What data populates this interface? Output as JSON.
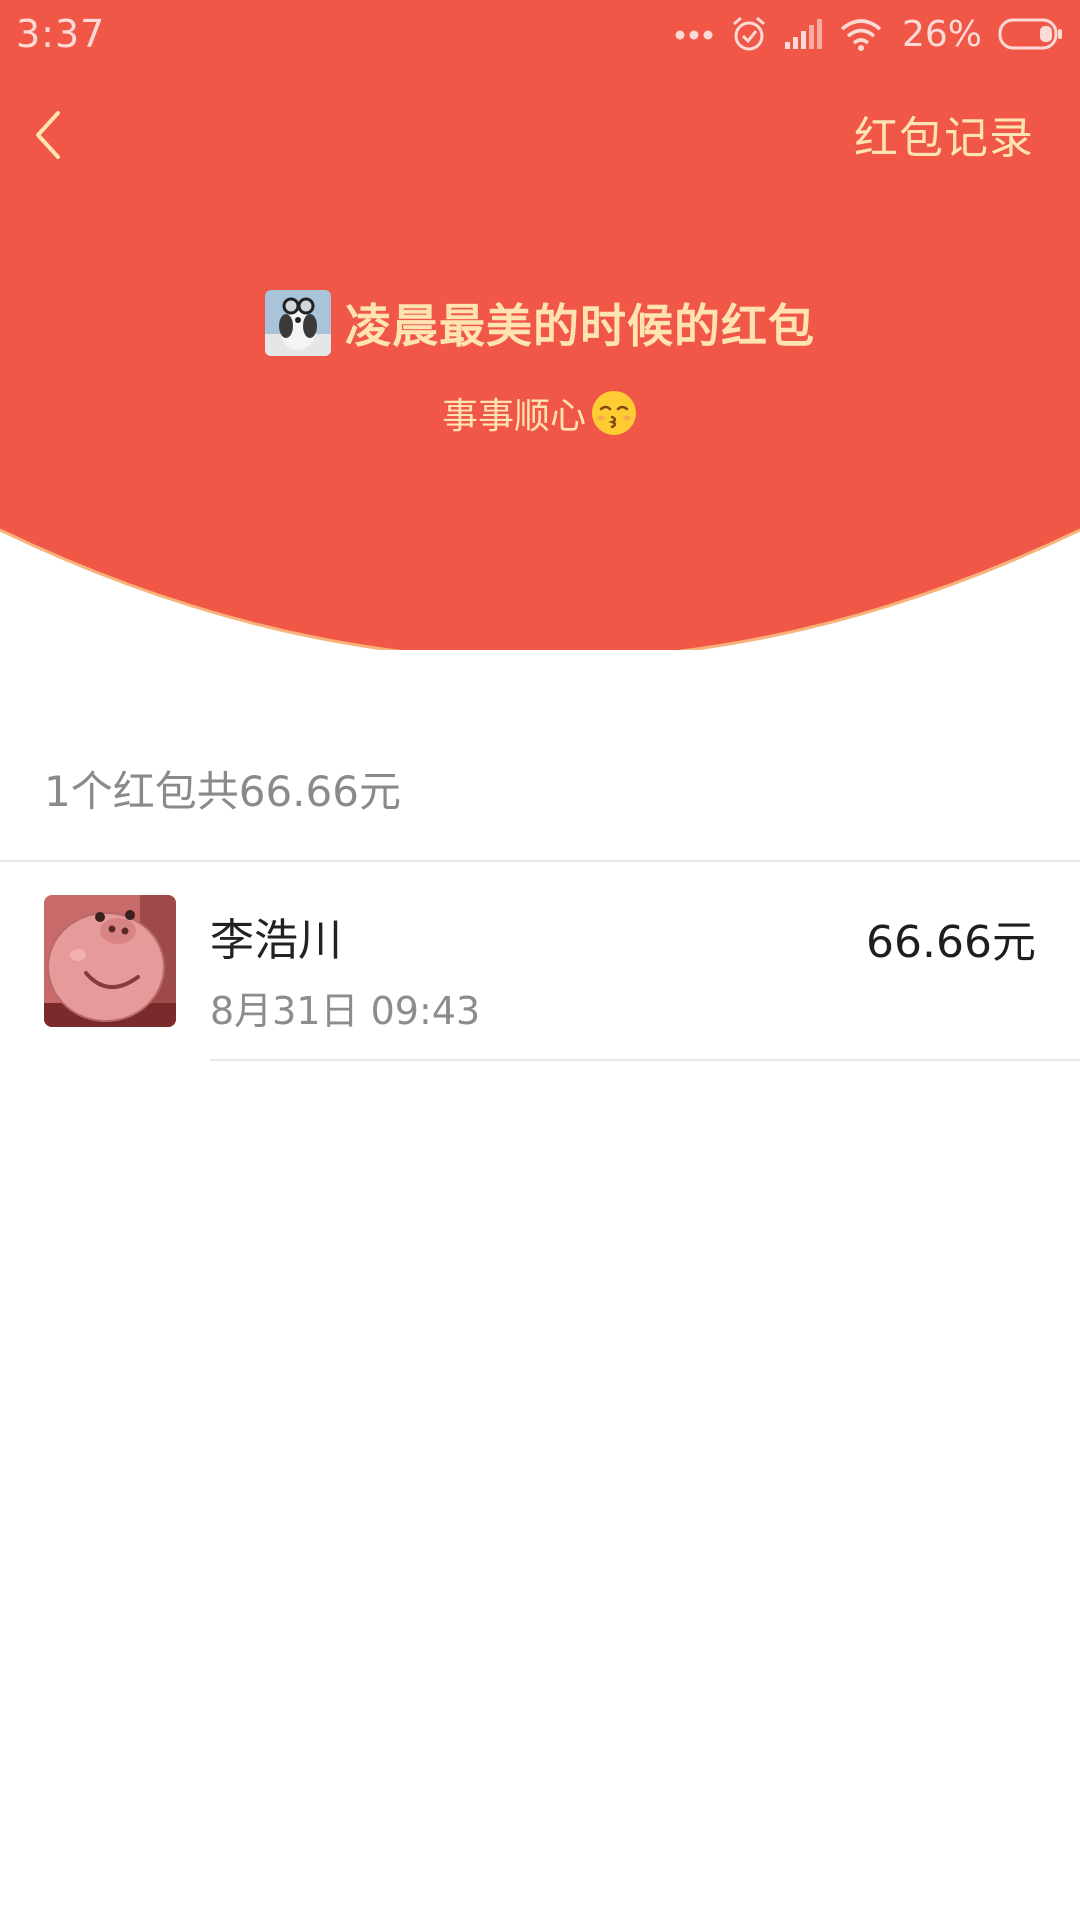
{
  "status_bar": {
    "time": "3:37",
    "battery": "26%"
  },
  "nav": {
    "back_icon": "chevron-left-icon",
    "records_label": "红包记录"
  },
  "packet": {
    "sender_title": "凌晨最美的时候的红包",
    "greeting": "事事顺心"
  },
  "summary": {
    "text": "1个红包共66.66元"
  },
  "records": [
    {
      "name": "李浩川",
      "time": "8月31日  09:43",
      "amount": "66.66元"
    }
  ],
  "colors": {
    "header_red": "#f15747",
    "gold_text": "#ffe3b3",
    "curve_edge": "#f7b27a"
  }
}
